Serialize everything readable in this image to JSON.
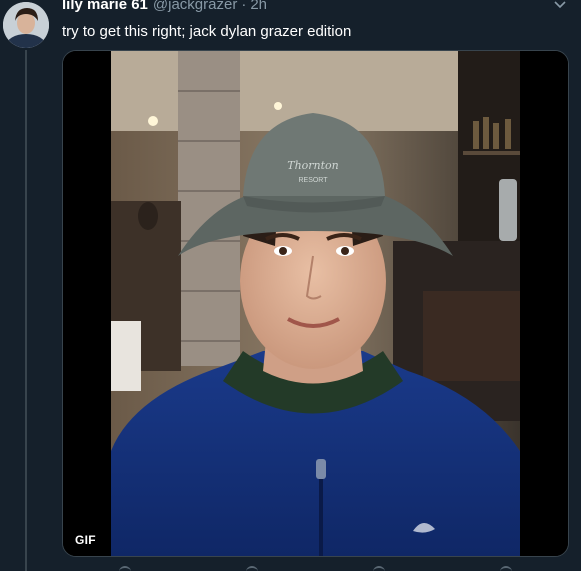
{
  "tweet": {
    "display_name": "lily marie 61",
    "handle": "@jackgrazer",
    "separator": "·",
    "timestamp": "2h",
    "text": "try to get this right; jack dylan grazer edition",
    "avatar_icon": "user-avatar",
    "menu_icon": "chevron-down-icon"
  },
  "media": {
    "badge": "GIF",
    "type": "animated-gif",
    "cap_text": "Thornton Resort"
  },
  "colors": {
    "background": "#15202b",
    "primary_text": "#ffffff",
    "secondary_text": "#8899a6",
    "divider": "#38444d"
  }
}
